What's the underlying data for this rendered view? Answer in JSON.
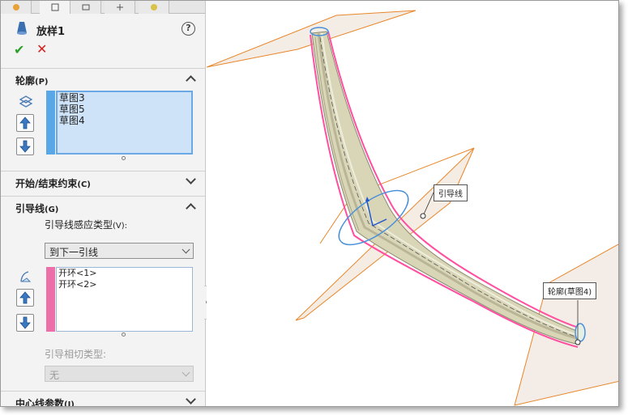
{
  "feature": {
    "title": "放样1",
    "help_symbol": "?",
    "ok_symbol": "✔",
    "cancel_symbol": "✕"
  },
  "profiles": {
    "heading": "轮廓",
    "shortcut": "(P)",
    "items": [
      "草图3",
      "草图5",
      "草图4"
    ]
  },
  "constraints": {
    "heading": "开始/结束约束",
    "shortcut": "(C)"
  },
  "guides": {
    "heading": "引导线",
    "shortcut": "(G)",
    "influence_label": "引导线感应类型",
    "influence_shortcut": "(V):",
    "influence_value": "到下一引线",
    "items": [
      "开环<1>",
      "开环<2>"
    ],
    "tangency_label": "引导相切类型:",
    "tangency_value": "无"
  },
  "centerline": {
    "heading": "中心线参数",
    "shortcut": "(I)"
  },
  "viewport": {
    "callout_guide": "引导线",
    "callout_profile": "轮廓(草图4)"
  },
  "colors": {
    "profile_stripe": "#5aa7e8",
    "guide_stripe": "#ec6fa8",
    "plane_edge": "#e8862a",
    "surface": "#d9d6b8",
    "guide_curve": "#ff4fa0"
  }
}
